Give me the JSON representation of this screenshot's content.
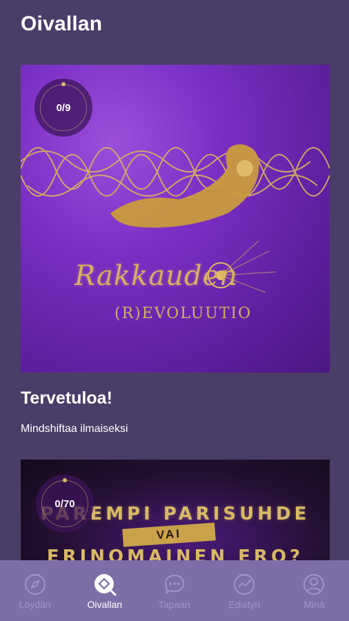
{
  "header": {
    "title": "Oivallan"
  },
  "cards": [
    {
      "progress": "0/9",
      "cover_title": "Rakkauden",
      "cover_subtitle": "(R)EVOLUUTIO",
      "heading": "Tervetuloa!",
      "description": "Mindshiftaa ilmaiseksi"
    },
    {
      "progress": "0/70",
      "cover_line1": "PAREMPI PARISUHDE",
      "cover_mid": "VAI",
      "cover_line2": "ERINOMAINEN ERO?"
    }
  ],
  "nav": {
    "items": [
      {
        "label": "Löydän",
        "icon": "compass-icon",
        "active": false
      },
      {
        "label": "Oivallan",
        "icon": "search-icon",
        "active": true
      },
      {
        "label": "Tapaan",
        "icon": "chat-icon",
        "active": false
      },
      {
        "label": "Edistyn",
        "icon": "progress-chart-icon",
        "active": false
      },
      {
        "label": "Minä",
        "icon": "profile-icon",
        "active": false
      }
    ]
  },
  "colors": {
    "background": "#4a3e68",
    "nav_background": "#7e6ea8",
    "accent_gold": "#d7b160",
    "nav_inactive": "#a396c6"
  }
}
